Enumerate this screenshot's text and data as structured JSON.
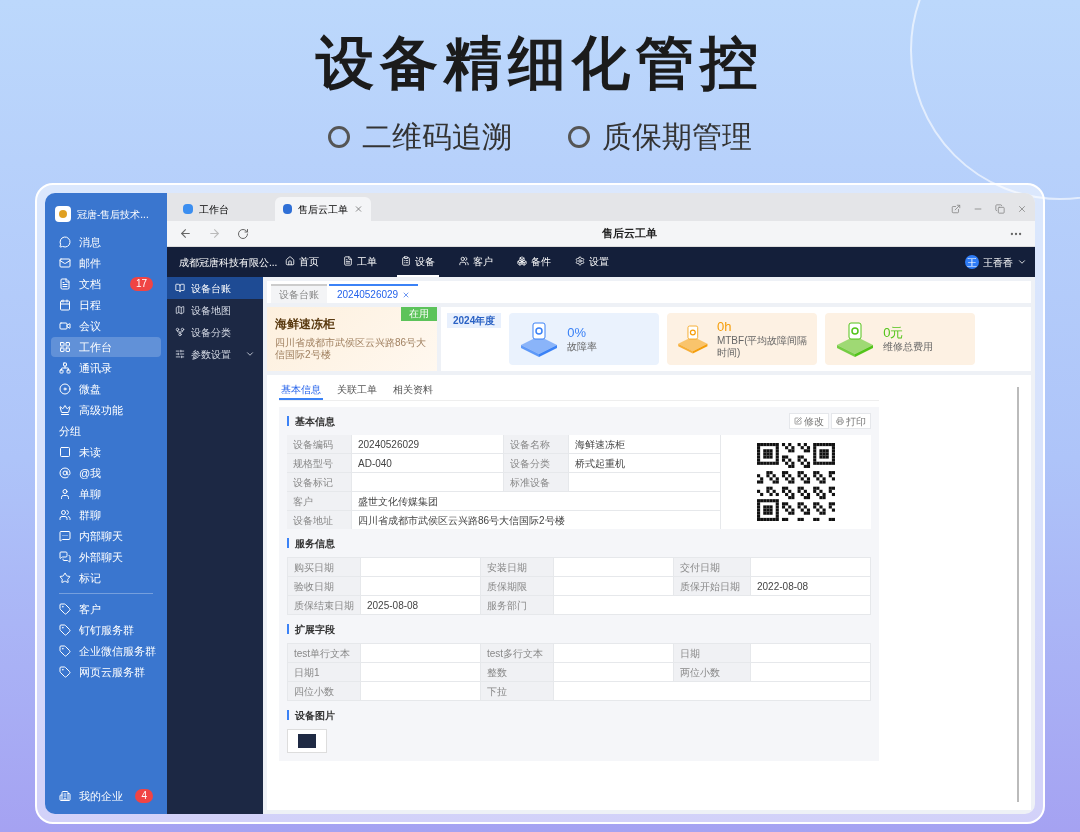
{
  "headline": "设备精细化管控",
  "features": [
    "二维码追溯",
    "质保期管理"
  ],
  "sidebar": {
    "org": "冠唐-售后技术...",
    "items": [
      {
        "label": "消息",
        "selected": false
      },
      {
        "label": "邮件",
        "selected": false
      },
      {
        "label": "文档",
        "selected": false,
        "badge": "17"
      },
      {
        "label": "日程",
        "selected": false
      },
      {
        "label": "会议",
        "selected": false
      },
      {
        "label": "工作台",
        "selected": true
      },
      {
        "label": "通讯录",
        "selected": false
      },
      {
        "label": "微盘",
        "selected": false
      },
      {
        "label": "高级功能",
        "selected": false
      }
    ],
    "group_title": "分组",
    "groups": [
      {
        "label": "未读",
        "selected": false
      },
      {
        "label": "@我",
        "selected": false
      },
      {
        "label": "单聊",
        "selected": false
      },
      {
        "label": "群聊",
        "selected": false
      },
      {
        "label": "内部聊天",
        "selected": false
      },
      {
        "label": "外部聊天",
        "selected": false
      },
      {
        "label": "标记",
        "selected": false
      }
    ],
    "shortcuts": [
      {
        "label": "客户",
        "selected": false
      },
      {
        "label": "钉钉服务群",
        "selected": false
      },
      {
        "label": "企业微信服务群",
        "selected": false
      },
      {
        "label": "网页云服务群",
        "selected": false
      }
    ],
    "footer": {
      "label": "我的企业",
      "badge": "4"
    }
  },
  "browser": {
    "tabs": [
      {
        "label": "工作台",
        "selected": false
      },
      {
        "label": "售后云工单",
        "selected": true
      }
    ],
    "title": "售后云工单"
  },
  "app": {
    "company": "成都冠唐科技有限公...",
    "nav": [
      {
        "label": "首页",
        "selected": false
      },
      {
        "label": "工单",
        "selected": false
      },
      {
        "label": "设备",
        "selected": true
      },
      {
        "label": "客户",
        "selected": false
      },
      {
        "label": "备件",
        "selected": false
      },
      {
        "label": "设置",
        "selected": false
      }
    ],
    "user": {
      "avatar": "王",
      "name": "王香香"
    }
  },
  "side_menu": [
    {
      "label": "设备台账",
      "selected": true
    },
    {
      "label": "设备地图",
      "selected": false
    },
    {
      "label": "设备分类",
      "selected": false
    },
    {
      "label": "参数设置",
      "selected": false,
      "expandable": true
    }
  ],
  "page_tabs": [
    {
      "label": "设备台账",
      "selected": false
    },
    {
      "label": "20240526029",
      "selected": true
    }
  ],
  "device": {
    "name": "海鲜速冻柜",
    "status": "在用",
    "address": "四川省成都市武侯区云兴路86号大信国际2号楼"
  },
  "stats": {
    "year": "2024年度",
    "cards": [
      {
        "value": "0%",
        "label": "故障率",
        "color": "#3b82f6"
      },
      {
        "value": "0h",
        "label": "MTBF(平均故障间隔时间)",
        "color": "#f59e0b"
      },
      {
        "value": "0元",
        "label": "维修总费用",
        "color": "#52c41a"
      }
    ]
  },
  "detail_tabs": [
    {
      "label": "基本信息",
      "selected": true
    },
    {
      "label": "关联工单",
      "selected": false
    },
    {
      "label": "相关资料",
      "selected": false
    }
  ],
  "basic": {
    "title": "基本信息",
    "actions": [
      "修改",
      "打印"
    ],
    "rows": [
      [
        {
          "label": "设备编码",
          "value": "20240526029"
        },
        {
          "label": "设备名称",
          "value": "海鲜速冻柜"
        }
      ],
      [
        {
          "label": "规格型号",
          "value": "AD-040"
        },
        {
          "label": "设备分类",
          "value": "桥式起重机"
        }
      ],
      [
        {
          "label": "设备标记"
        },
        {
          "label": "标准设备"
        }
      ],
      [
        {
          "label": "客户",
          "value": "盛世文化传媒集团"
        }
      ],
      [
        {
          "label": "设备地址",
          "value": "四川省成都市武侯区云兴路86号大信国际2号楼"
        }
      ]
    ]
  },
  "service": {
    "title": "服务信息",
    "rows": [
      [
        {
          "label": "购买日期"
        },
        {
          "label": "安装日期"
        },
        {
          "label": "交付日期"
        }
      ],
      [
        {
          "label": "验收日期"
        },
        {
          "label": "质保期限"
        },
        {
          "label": "质保开始日期",
          "value": "2022-08-08"
        }
      ],
      [
        {
          "label": "质保结束日期",
          "value": "2025-08-08"
        },
        {
          "label": "服务部门"
        }
      ]
    ]
  },
  "extension": {
    "title": "扩展字段",
    "rows": [
      [
        {
          "label": "test单行文本"
        },
        {
          "label": "test多行文本"
        },
        {
          "label": "日期"
        }
      ],
      [
        {
          "label": "日期1"
        },
        {
          "label": "整数"
        },
        {
          "label": "两位小数"
        }
      ],
      [
        {
          "label": "四位小数"
        },
        {
          "label": "下拉"
        }
      ]
    ]
  },
  "photos": {
    "title": "设备图片"
  }
}
